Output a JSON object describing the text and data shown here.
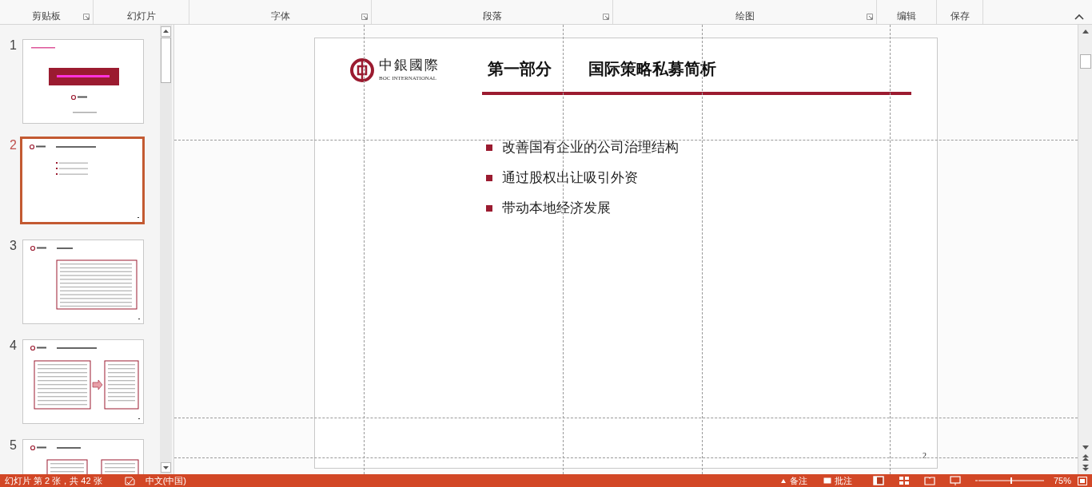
{
  "ribbon_groups": [
    {
      "label": "剪贴板",
      "launcher": true
    },
    {
      "label": "幻灯片",
      "launcher": false
    },
    {
      "label": "字体",
      "launcher": true
    },
    {
      "label": "段落",
      "launcher": true
    },
    {
      "label": "绘图",
      "launcher": true
    },
    {
      "label": "编辑",
      "launcher": false
    },
    {
      "label": "保存",
      "launcher": false
    }
  ],
  "slides": [
    {
      "number": "1",
      "selected": false
    },
    {
      "number": "2",
      "selected": true
    },
    {
      "number": "3",
      "selected": false
    },
    {
      "number": "4",
      "selected": false
    },
    {
      "number": "5",
      "selected": false
    }
  ],
  "slide": {
    "logo_cn": "中銀國際",
    "logo_en": "BOC INTERNATIONAL",
    "section": "第一部分",
    "title": "国际策略私募简析",
    "bullets": [
      "改善国有企业的公司治理结构",
      "通过股权出让吸引外资",
      "带动本地经济发展"
    ],
    "page_number": "2"
  },
  "status_bar": {
    "slide_info": "幻灯片 第 2 张，共 42 张",
    "language": "中文(中国)",
    "notes": "备注",
    "comments": "批注",
    "zoom": "75%"
  }
}
